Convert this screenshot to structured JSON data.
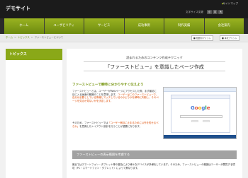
{
  "header": {
    "site_title": "デモサイト",
    "sitemap_label": "サイトマップ",
    "sitemap_marker": "▶",
    "fontsize_label": "文字サイズ変更",
    "fontsize_buttons": [
      "小",
      "中",
      "大"
    ]
  },
  "nav": {
    "items": [
      "ホーム",
      "ユーザビリティ",
      "サービス",
      "成功事例",
      "制作実績",
      "会社案内"
    ]
  },
  "breadcrumb": {
    "home": "ホーム",
    "sep": ">",
    "topics": "トピックス",
    "current": "ファーストビューについて"
  },
  "print": {
    "color_label": "■ 色数印プリント",
    "text_label": "■ 本文プリント"
  },
  "sidebar": {
    "heading": "トピックス"
  },
  "main": {
    "lead_small": "読まれるためのコンテンツ作成テクニック",
    "lead_big": "「ファーストビュー」を意識したページ作成",
    "section1_heading": "ファーストビューで瞬時に分かりやすく伝えよう",
    "p1_part1": "ファーストビューとは、ユーザーがWebページにアクセスした際、まず最初に目に入る画面の範囲のことを意味します。",
    "p1_highlight": "ユーザーはこのファーストビューで、自分が必要としている情報とマッチしているのかどうかを瞬時に判断し、そのページを見るか見ないかを決定します。",
    "p2_part1": "そのため、ファーストビューでは",
    "p2_highlight": "「ユーザー側目に止まるために以外を知せるべきか」",
    "p2_part2": "を意識したレイアウト設計を行うことが重要になります。",
    "section2_bar": "ファーストビューの表示範囲を考慮する",
    "p3": "最近ではスマートフォン・タブレット等の普及により様々なデバイスが多様化しています。そのため、ファーストビューの範囲はユーザーが閲覧する環境（PC・スマートフォン・タブレット）によって異なります。"
  },
  "screenshot_thumb": {
    "logo": [
      "G",
      "o",
      "o",
      "g",
      "l",
      "e"
    ]
  },
  "colors": {
    "accent_green": "#8aa818",
    "highlight_orange": "#dc4a00",
    "header_bg": "#1b1b1b"
  }
}
